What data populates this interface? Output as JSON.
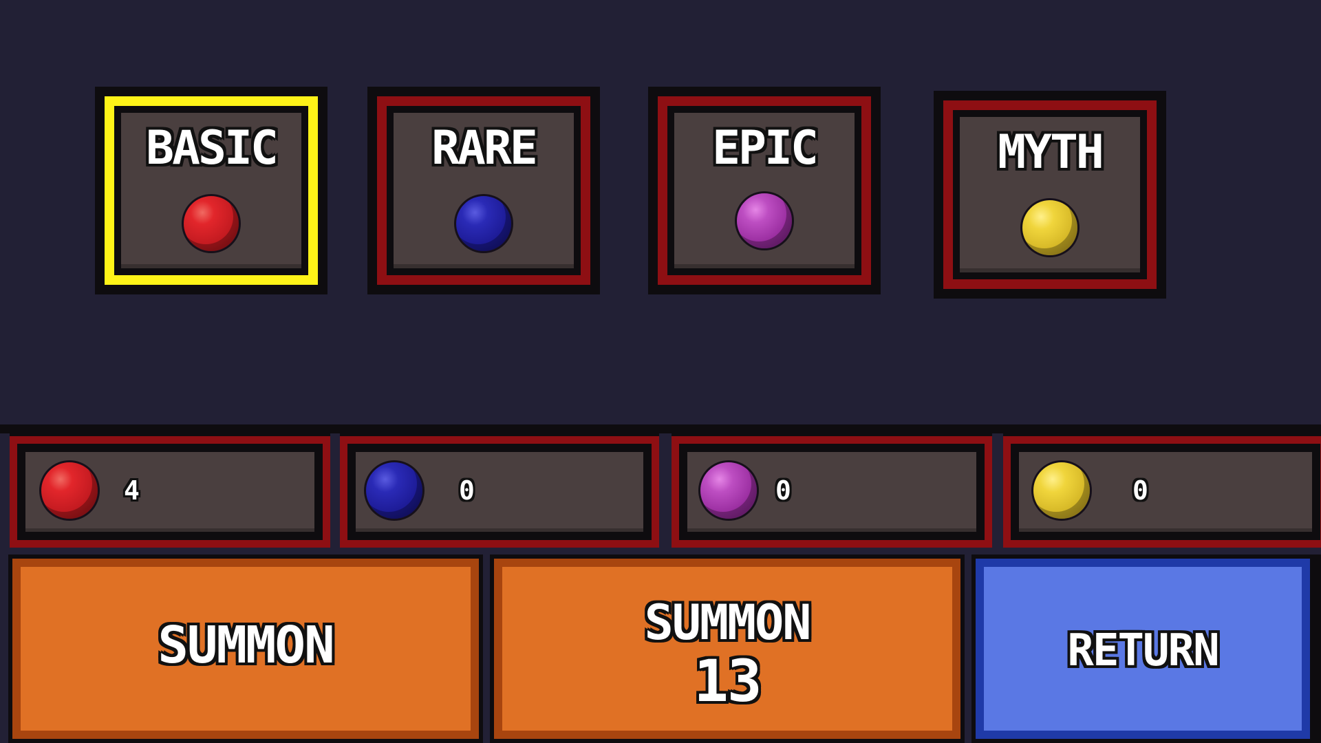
{
  "tiers": [
    {
      "label": "BASIC",
      "orb_color": "red",
      "selected": true
    },
    {
      "label": "RARE",
      "orb_color": "blue",
      "selected": false
    },
    {
      "label": "EPIC",
      "orb_color": "purple",
      "selected": false
    },
    {
      "label": "MYTH",
      "orb_color": "yellow",
      "selected": false
    }
  ],
  "inventory": [
    {
      "orb_color": "red",
      "count": "4"
    },
    {
      "orb_color": "blue",
      "count": "0"
    },
    {
      "orb_color": "purple",
      "count": "0"
    },
    {
      "orb_color": "yellow",
      "count": "0"
    }
  ],
  "buttons": {
    "summon": "SUMMON",
    "summon_multi_label": "SUMMON",
    "summon_multi_count": "13",
    "return": "RETURN"
  },
  "colors": {
    "background": "#222035",
    "frame_red": "#8e0f13",
    "frame_selected": "#fff318",
    "panel": "#4a3f3f",
    "button_orange": "#e07125",
    "button_blue": "#5a78e4",
    "orb_red": "#d4222a",
    "orb_blue": "#2424a8",
    "orb_purple": "#b044b6",
    "orb_yellow": "#e8cc34"
  }
}
